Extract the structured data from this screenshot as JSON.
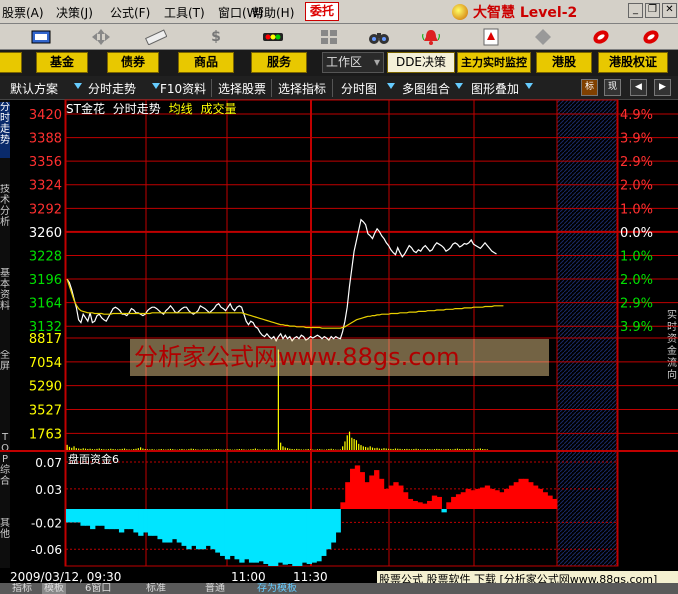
{
  "menu": {
    "items": [
      "股票(A)",
      "决策(J)",
      "公式(F)",
      "工具(T)",
      "窗口(W)",
      "帮助(H)"
    ],
    "weituo": "委托",
    "brand": "大智慧 Level-2"
  },
  "toolbar": {
    "icons": [
      "screen-icon",
      "move-icon",
      "ruler-icon",
      "dollar-icon",
      "traffic-light-icon",
      "grid-icon",
      "binoculars-icon",
      "bell-icon",
      "alert-icon",
      "diamond-icon",
      "flame-icon",
      "flame-alt-icon"
    ]
  },
  "nav": {
    "buttons": [
      "基金",
      "债券",
      "商品",
      "服务"
    ],
    "workspace": "工作区",
    "right_buttons": [
      "DDE决策",
      "主力实时监控",
      "港股",
      "港股权证"
    ]
  },
  "subbar": {
    "items": [
      "默认方案",
      "分时走势",
      "F10资料",
      "选择股票",
      "选择指标",
      "分时图",
      "多图组合",
      "图形叠加"
    ],
    "biao": "标",
    "xian": "现"
  },
  "chart_header": {
    "name": "ST金花",
    "mode": "分时走势",
    "avg": "均线",
    "vol": "成交量"
  },
  "sidebar": {
    "tabs": [
      "分时走势",
      "技术分析",
      "基本资料",
      "全屏",
      "TOP综合",
      "其他"
    ]
  },
  "right_column": "实时资金流向",
  "watermark": "分析家公式网www.88gs.com",
  "sub_chart_label": "盘面资金6",
  "status": {
    "datetime": "2009/03/12, 09:30",
    "time_1100": "11:00",
    "time_1130": "11:30",
    "promo": "股票公式 股票软件 下载 [分析家公式网www.88gs.com]",
    "tabs": [
      "指标",
      "模板",
      "6窗口",
      "标准",
      "普通",
      "存为模板"
    ]
  },
  "colors": {
    "up": "#ff3030",
    "down": "#00e000",
    "flat": "#ffffff",
    "volume": "#ffff00",
    "avg_line": "#e8d000",
    "price_line": "#ffffff",
    "grid": "#c00000",
    "fund_pos": "#ff0000",
    "fund_neg": "#00e5ff",
    "menu_bg": "#d4d0c8",
    "nav_btn": "#e8c800"
  },
  "chart_data": {
    "type": "line",
    "y_left_price_ticks": [
      "3420",
      "3388",
      "3356",
      "3324",
      "3292",
      "3260",
      "3228",
      "3196",
      "3164",
      "3132"
    ],
    "y_right_pct_ticks": [
      "4.9%",
      "3.9%",
      "2.9%",
      "2.0%",
      "1.0%",
      "0.0%",
      "1.0%",
      "2.0%",
      "2.9%",
      "3.9%"
    ],
    "price_ylim": [
      3116,
      3436
    ],
    "prev_close": 3260,
    "y_left_volume_ticks": [
      "8817",
      "7054",
      "5290",
      "3527",
      "1763"
    ],
    "volume_ylim": [
      0,
      8817
    ],
    "fund_ticks": [
      "0.07",
      "0.03",
      "-0.02",
      "-0.06"
    ],
    "fund_ylim": [
      -0.085,
      0.085
    ],
    "x_labels": [
      "09:30",
      "11:00",
      "11:30"
    ],
    "bars_total": 240,
    "series": [
      {
        "name": "price",
        "values": [
          3200,
          3195,
          3185,
          3172,
          3160,
          3142,
          3138,
          3150,
          3145,
          3140,
          3152,
          3138,
          3140,
          3148,
          3150,
          3145,
          3142,
          3140,
          3146,
          3152,
          3158,
          3160,
          3158,
          3155,
          3150,
          3150,
          3148,
          3152,
          3158,
          3156,
          3152,
          3152,
          3150,
          3148,
          3150,
          3155,
          3158,
          3160,
          3160,
          3158,
          3155,
          3152,
          3150,
          3155,
          3158,
          3162,
          3158,
          3153,
          3152,
          3155,
          3158,
          3160,
          3160,
          3155,
          3152,
          3150,
          3152,
          3155,
          3162,
          3160,
          3158,
          3155,
          3152,
          3155,
          3158,
          3163,
          3165,
          3160,
          3158,
          3155,
          3160,
          3165,
          3158,
          3155,
          3160,
          3162,
          3160,
          3150,
          3140,
          3135,
          3140,
          3138,
          3132,
          3130,
          3124,
          3120,
          3118,
          3122,
          3118,
          3115,
          3118,
          3112,
          3118,
          3122,
          3115,
          3120,
          3115,
          3118,
          3112,
          3116,
          3118,
          3115,
          3120,
          3118,
          3113,
          3115,
          3118,
          3116,
          3118,
          3120,
          3118,
          3115,
          3118,
          3116,
          3113,
          3118,
          3115,
          3118,
          3116,
          3115,
          3125,
          3140,
          3160,
          3190,
          3215,
          3240,
          3255,
          3270,
          3285,
          3282,
          3278,
          3265,
          3262,
          3258,
          3266,
          3272,
          3268,
          3262,
          3258,
          3252,
          3248,
          3242,
          3238,
          3235,
          3245,
          3238,
          3232,
          3236,
          3242,
          3248,
          3245,
          3240,
          3238,
          3242,
          3240,
          3245,
          3248,
          3244,
          3240,
          3242,
          3248,
          3252,
          3250,
          3248,
          3245,
          3240,
          3242,
          3245,
          3250,
          3252,
          3250,
          3246,
          3248,
          3251,
          3250,
          3252,
          3256,
          3250,
          3248,
          3246,
          3244,
          3248,
          3252,
          3248,
          3244,
          3240,
          3238,
          3236
        ],
        "color": "#ffffff"
      },
      {
        "name": "avg",
        "values": [
          3200,
          3190,
          3180,
          3170,
          3163,
          3158,
          3155,
          3154,
          3153,
          3152,
          3152,
          3152,
          3151,
          3151,
          3151,
          3151,
          3150,
          3150,
          3150,
          3150,
          3151,
          3151,
          3151,
          3151,
          3151,
          3151,
          3151,
          3151,
          3151,
          3151,
          3151,
          3151,
          3151,
          3151,
          3151,
          3151,
          3151,
          3152,
          3152,
          3152,
          3152,
          3152,
          3152,
          3152,
          3152,
          3152,
          3152,
          3152,
          3152,
          3152,
          3152,
          3152,
          3152,
          3152,
          3152,
          3152,
          3152,
          3152,
          3152,
          3152,
          3152,
          3152,
          3152,
          3152,
          3152,
          3152,
          3152,
          3152,
          3152,
          3152,
          3152,
          3152,
          3152,
          3152,
          3152,
          3152,
          3152,
          3151,
          3150,
          3149,
          3148,
          3147,
          3146,
          3145,
          3144,
          3143,
          3142,
          3141,
          3140,
          3139,
          3138,
          3137,
          3136,
          3135,
          3135,
          3134,
          3134,
          3133,
          3133,
          3133,
          3132,
          3132,
          3132,
          3132,
          3131,
          3131,
          3131,
          3131,
          3131,
          3131,
          3131,
          3130,
          3130,
          3130,
          3130,
          3130,
          3130,
          3130,
          3130,
          3130,
          3131,
          3132,
          3134,
          3136,
          3138,
          3140,
          3142,
          3143,
          3144,
          3145,
          3146,
          3147,
          3147,
          3148,
          3148,
          3149,
          3149,
          3150,
          3150,
          3150,
          3150,
          3151,
          3151,
          3151,
          3151,
          3152,
          3152,
          3152,
          3152,
          3153,
          3153,
          3153,
          3153,
          3154,
          3154,
          3154,
          3154,
          3155,
          3155,
          3155,
          3155,
          3156,
          3156,
          3156,
          3156,
          3157,
          3157,
          3157,
          3157,
          3158,
          3158,
          3158,
          3158,
          3159,
          3159,
          3159,
          3159,
          3160,
          3160,
          3160,
          3160,
          3160,
          3161,
          3161,
          3161,
          3161,
          3162,
          3162,
          3162,
          3162,
          3162
        ],
        "color": "#e8d000"
      }
    ],
    "volume": [
      420,
      260,
      180,
      300,
      150,
      120,
      90,
      140,
      110,
      80,
      100,
      70,
      60,
      90,
      120,
      80,
      60,
      50,
      70,
      100,
      80,
      60,
      50,
      70,
      90,
      120,
      60,
      50,
      40,
      80,
      100,
      150,
      220,
      120,
      80,
      60,
      50,
      70,
      40,
      30,
      60,
      80,
      50,
      40,
      60,
      90,
      70,
      40,
      30,
      60,
      80,
      50,
      40,
      70,
      110,
      90,
      60,
      40,
      30,
      50,
      60,
      70,
      40,
      30,
      50,
      80,
      60,
      40,
      30,
      40,
      60,
      50,
      30,
      40,
      60,
      80,
      70,
      50,
      30,
      40,
      60,
      80,
      120,
      60,
      40,
      30,
      70,
      50,
      40,
      60,
      30,
      40,
      8200,
      600,
      300,
      200,
      150,
      100,
      80,
      60,
      90,
      70,
      50,
      40,
      60,
      80,
      50,
      40,
      30,
      60,
      70,
      40,
      30,
      50,
      80,
      100,
      60,
      40,
      30,
      50,
      300,
      700,
      1200,
      1500,
      1000,
      900,
      800,
      500,
      400,
      300,
      250,
      200,
      300,
      200,
      150,
      180,
      120,
      100,
      150,
      120,
      100,
      90,
      80,
      120,
      100,
      90,
      60,
      80,
      90,
      70,
      60,
      80,
      100,
      70,
      60,
      50,
      80,
      70,
      60,
      50,
      70,
      90,
      80,
      60,
      50,
      70,
      80,
      60,
      50,
      90,
      110,
      80,
      70,
      60,
      80,
      90,
      70,
      60,
      80,
      100,
      120,
      80,
      70,
      60
    ],
    "fund_flow": [
      -0.02,
      -0.02,
      -0.02,
      -0.025,
      -0.025,
      -0.03,
      -0.025,
      -0.025,
      -0.03,
      -0.03,
      -0.03,
      -0.035,
      -0.03,
      -0.03,
      -0.035,
      -0.04,
      -0.035,
      -0.04,
      -0.04,
      -0.045,
      -0.05,
      -0.05,
      -0.045,
      -0.05,
      -0.055,
      -0.06,
      -0.055,
      -0.06,
      -0.06,
      -0.055,
      -0.06,
      -0.065,
      -0.07,
      -0.075,
      -0.07,
      -0.075,
      -0.08,
      -0.075,
      -0.08,
      -0.08,
      -0.078,
      -0.082,
      -0.085,
      -0.085,
      -0.08,
      -0.083,
      -0.082,
      -0.085,
      -0.085,
      -0.08,
      -0.082,
      -0.08,
      -0.078,
      -0.07,
      -0.06,
      -0.05,
      -0.035,
      0.01,
      0.04,
      0.06,
      0.065,
      0.055,
      0.04,
      0.05,
      0.058,
      0.045,
      0.03,
      0.035,
      0.04,
      0.035,
      0.025,
      0.015,
      0.012,
      0.01,
      0.008,
      0.012,
      0.02,
      0.018,
      -0.005,
      0.01,
      0.018,
      0.022,
      0.025,
      0.03,
      0.028,
      0.03,
      0.032,
      0.035,
      0.03,
      0.028,
      0.025,
      0.03,
      0.035,
      0.04,
      0.045,
      0.045,
      0.04,
      0.035,
      0.03,
      0.025,
      0.02,
      0.015
    ]
  }
}
